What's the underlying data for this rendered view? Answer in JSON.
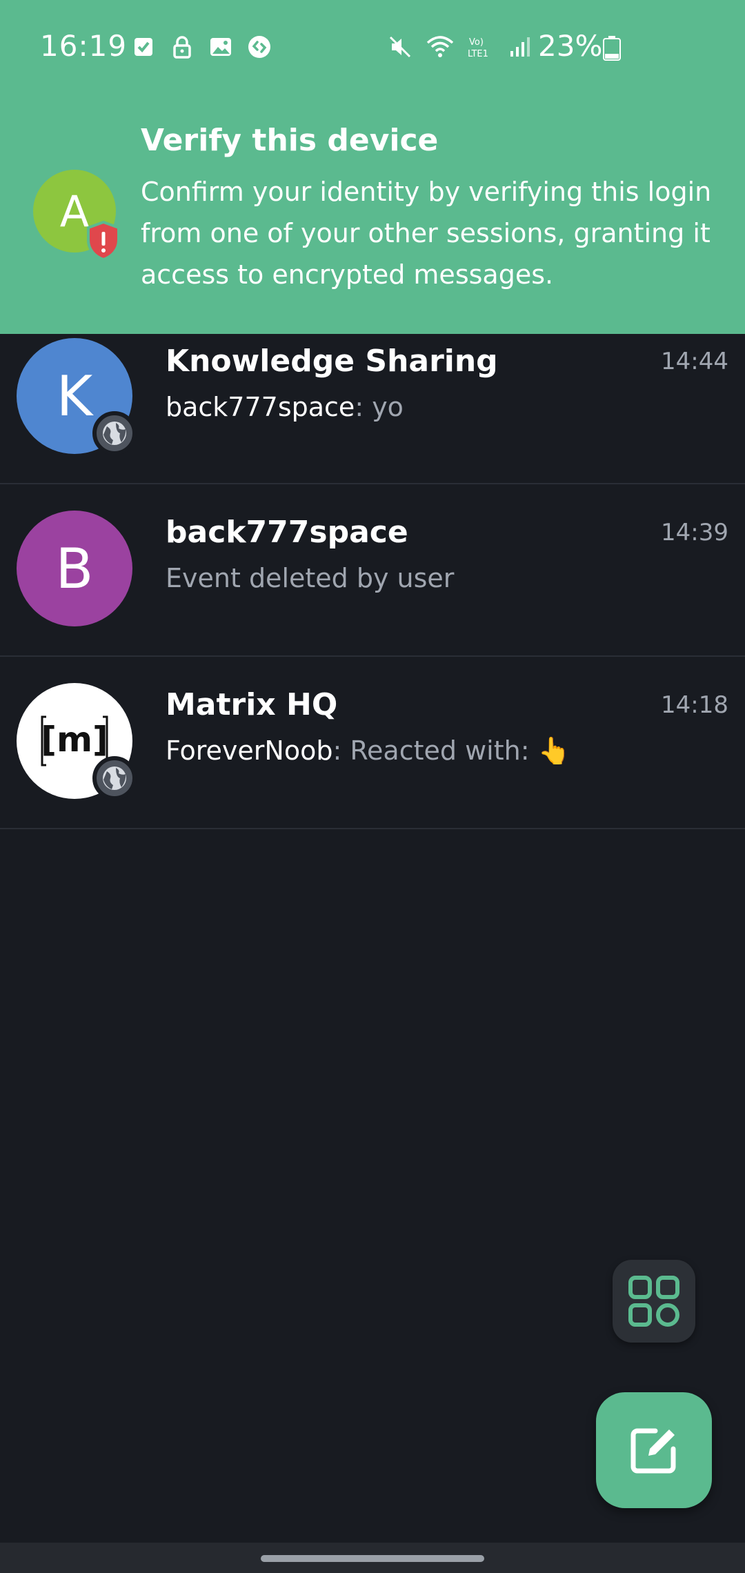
{
  "status_bar": {
    "time": "16:19",
    "left_icons": [
      "check-box-icon",
      "lock-icon",
      "image-icon",
      "shazam-icon"
    ],
    "right_icons": [
      "mute-icon",
      "wifi-icon",
      "volte-icon",
      "signal-icon"
    ],
    "battery_text": "23%"
  },
  "verify_banner": {
    "avatar_letter": "A",
    "title": "Verify this device",
    "body": "Confirm your identity by verifying this login from one of your other sessions, granting it access to encrypted messages.",
    "accent": "#5bba8f"
  },
  "rooms": [
    {
      "avatar_letter": "K",
      "avatar_color": "#4f86d0",
      "name": "Knowledge Sharing",
      "time": "14:44",
      "sender": "back777space",
      "preview": ": yo",
      "public": true
    },
    {
      "avatar_letter": "B",
      "avatar_color": "#9b42a0",
      "name": "back777space",
      "time": "14:39",
      "sender": "",
      "preview": "Event deleted by user",
      "public": false
    },
    {
      "avatar_letter": "[m]",
      "avatar_color": "#ffffff",
      "name": "Matrix HQ",
      "time": "14:18",
      "sender": "ForeverNoob",
      "preview": ": Reacted with: 👆",
      "public": true
    }
  ],
  "fabs": {
    "spaces_icon": "grid-icon",
    "compose_icon": "compose-icon"
  }
}
